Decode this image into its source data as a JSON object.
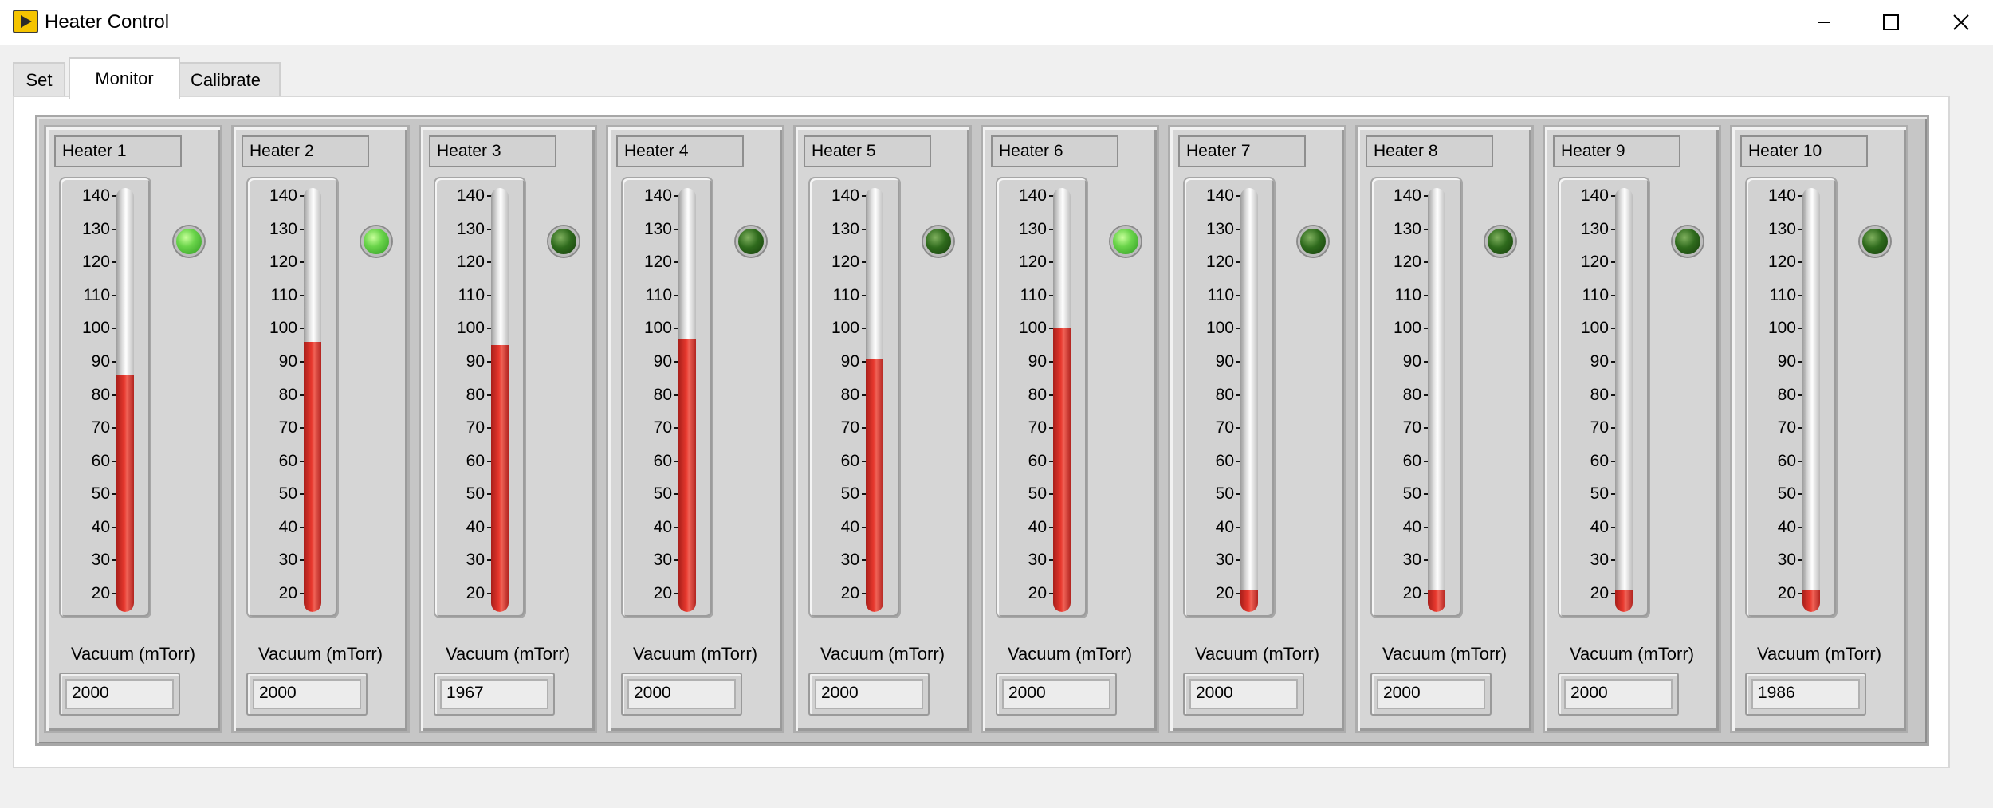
{
  "window": {
    "title": "Heater Control"
  },
  "tabs": [
    {
      "label": "Set"
    },
    {
      "label": "Monitor"
    },
    {
      "label": "Calibrate"
    }
  ],
  "active_tab": "Monitor",
  "colors": {
    "fill": "#e8382e",
    "led_on": "#6ad44a",
    "led_off": "#2e6a1c",
    "panel": "#d6d6d6"
  },
  "gauge": {
    "min": 20,
    "max": 140,
    "ticks": [
      "140",
      "130",
      "120",
      "110",
      "100",
      "90",
      "80",
      "70",
      "60",
      "50",
      "40",
      "30",
      "20"
    ]
  },
  "vacuum_label": "Vacuum (mTorr)",
  "heaters": [
    {
      "name": "Heater 1",
      "level": 87,
      "led": "on",
      "vacuum": "2000"
    },
    {
      "name": "Heater 2",
      "level": 97,
      "led": "on",
      "vacuum": "2000"
    },
    {
      "name": "Heater 3",
      "level": 96,
      "led": "off",
      "vacuum": "1967"
    },
    {
      "name": "Heater 4",
      "level": 98,
      "led": "off",
      "vacuum": "2000"
    },
    {
      "name": "Heater 5",
      "level": 92,
      "led": "off",
      "vacuum": "2000"
    },
    {
      "name": "Heater 6",
      "level": 101,
      "led": "on",
      "vacuum": "2000"
    },
    {
      "name": "Heater 7",
      "level": 22,
      "led": "off",
      "vacuum": "2000"
    },
    {
      "name": "Heater 8",
      "level": 22,
      "led": "off",
      "vacuum": "2000"
    },
    {
      "name": "Heater 9",
      "level": 22,
      "led": "off",
      "vacuum": "2000"
    },
    {
      "name": "Heater 10",
      "level": 22,
      "led": "off",
      "vacuum": "1986"
    }
  ]
}
